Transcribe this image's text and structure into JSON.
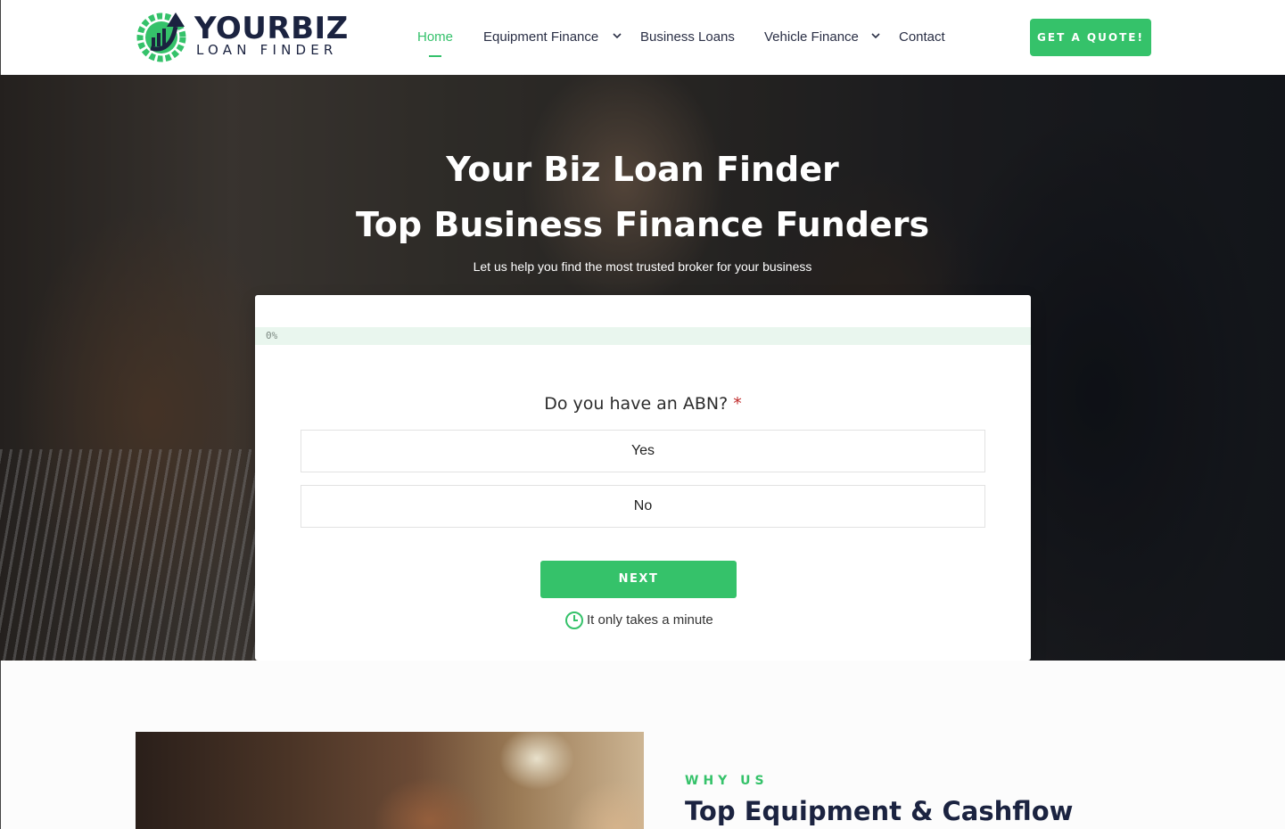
{
  "brand": {
    "name_line1": "YOURBIZ",
    "name_line2": "LOAN FINDER",
    "colors": {
      "accent": "#35c26a",
      "navy": "#1b2340"
    }
  },
  "nav": {
    "items": [
      {
        "label": "Home",
        "active": true
      },
      {
        "label": "Equipment Finance",
        "has_dropdown": true
      },
      {
        "label": "Business Loans"
      },
      {
        "label": "Vehicle Finance",
        "has_dropdown": true
      },
      {
        "label": "Contact"
      }
    ],
    "cta_label": "GET A QUOTE!"
  },
  "hero": {
    "title_line1": "Your Biz Loan Finder",
    "title_line2": "Top Business Finance Funders",
    "subtitle": "Let us help you find the most trusted broker for your business"
  },
  "form": {
    "progress_label": "0%",
    "progress_value": 0,
    "question": "Do you have an ABN?",
    "required_marker": "*",
    "options": [
      "Yes",
      "No"
    ],
    "next_label": "NEXT",
    "footnote": "It only takes a minute",
    "footnote_icon": "clock-icon"
  },
  "section": {
    "eyebrow": "WHY US",
    "heading": "Top Equipment & Cashflow"
  }
}
